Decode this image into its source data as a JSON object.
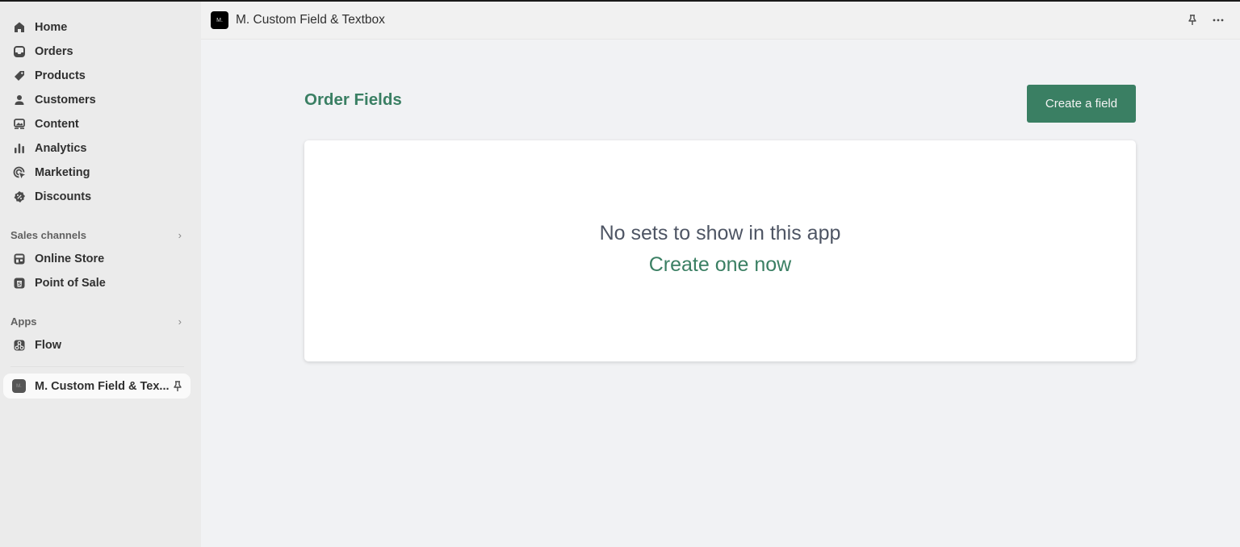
{
  "sidebar": {
    "nav": [
      {
        "label": "Home",
        "icon": "home-icon"
      },
      {
        "label": "Orders",
        "icon": "inbox-icon"
      },
      {
        "label": "Products",
        "icon": "tag-icon"
      },
      {
        "label": "Customers",
        "icon": "person-icon"
      },
      {
        "label": "Content",
        "icon": "image-icon"
      },
      {
        "label": "Analytics",
        "icon": "bar-chart-icon"
      },
      {
        "label": "Marketing",
        "icon": "target-icon"
      },
      {
        "label": "Discounts",
        "icon": "discount-icon"
      }
    ],
    "sales_channels": {
      "header": "Sales channels",
      "items": [
        {
          "label": "Online Store",
          "icon": "store-icon"
        },
        {
          "label": "Point of Sale",
          "icon": "pos-icon"
        }
      ]
    },
    "apps": {
      "header": "Apps",
      "items": [
        {
          "label": "Flow",
          "icon": "flow-icon"
        }
      ]
    },
    "active_app": {
      "label": "M. Custom Field & Tex...",
      "logo_text": "M."
    }
  },
  "header": {
    "logo_text": "M.",
    "title": "M. Custom Field & Textbox"
  },
  "main": {
    "page_title": "Order Fields",
    "create_button": "Create a field",
    "empty_state": {
      "title": "No sets to show in this app",
      "link": "Create one now"
    }
  },
  "colors": {
    "accent": "#3a7f63",
    "sidebar_bg": "#ebebeb",
    "main_bg": "#f1f2f4"
  }
}
